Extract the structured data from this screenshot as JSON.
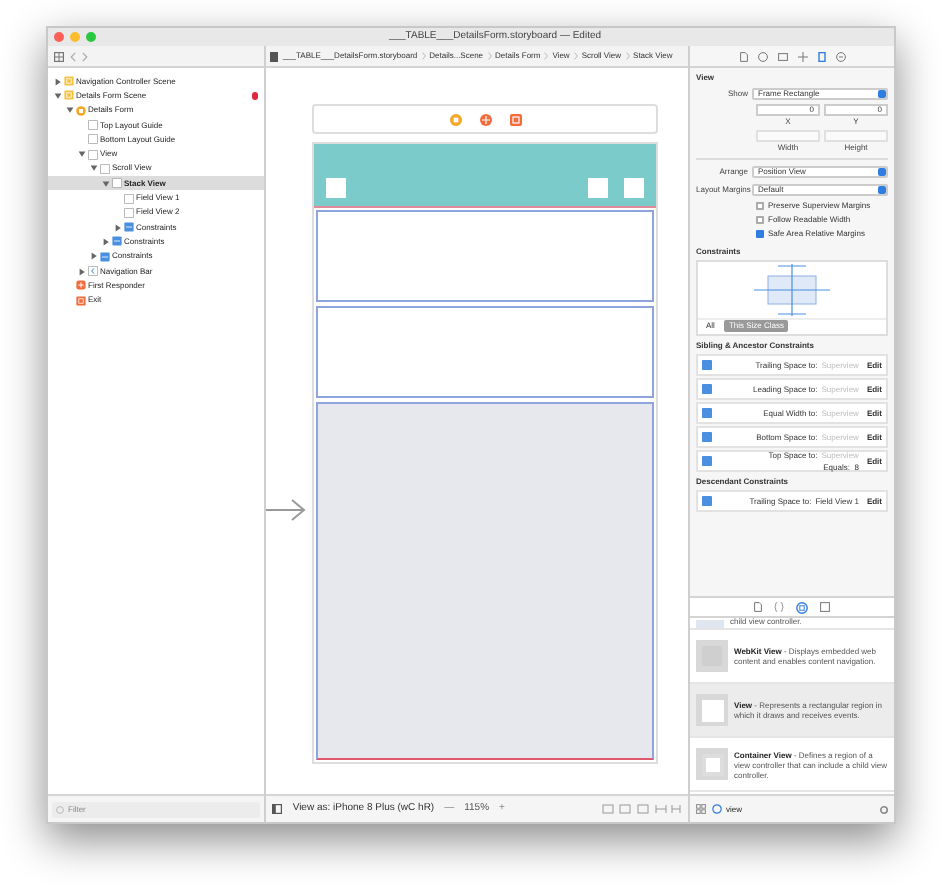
{
  "window": {
    "title": "___TABLE___DetailsForm.storyboard — Edited"
  },
  "path_bar": [
    "___TABLE___DetailsForm.storyboard",
    "Details...Scene",
    "Details Form",
    "View",
    "Scroll View",
    "Stack View"
  ],
  "outline": [
    {
      "label": "Navigation Controller Scene",
      "kind": "scene",
      "expanded": false,
      "selected": false
    },
    {
      "label": "Details Form Scene",
      "kind": "scene",
      "expanded": true,
      "selected": false,
      "error": true,
      "children": [
        {
          "label": "Details Form",
          "kind": "controller",
          "expanded": true,
          "selected": false,
          "children": [
            {
              "label": "Top Layout Guide",
              "kind": "view",
              "selected": false
            },
            {
              "label": "Bottom Layout Guide",
              "kind": "view",
              "selected": false
            },
            {
              "label": "View",
              "kind": "view",
              "expanded": true,
              "selected": false,
              "children": [
                {
                  "label": "Scroll View",
                  "kind": "view",
                  "expanded": true,
                  "selected": false,
                  "children": [
                    {
                      "label": "Stack View",
                      "kind": "view",
                      "expanded": true,
                      "selected": true,
                      "children": [
                        {
                          "label": "Field View 1",
                          "kind": "view",
                          "selected": false
                        },
                        {
                          "label": "Field View 2",
                          "kind": "view",
                          "selected": false
                        },
                        {
                          "label": "Constraints",
                          "kind": "constraints",
                          "expanded": false,
                          "selected": false
                        }
                      ]
                    },
                    {
                      "label": "Constraints",
                      "kind": "constraints",
                      "expanded": false,
                      "selected": false
                    }
                  ]
                },
                {
                  "label": "Constraints",
                  "kind": "constraints",
                  "expanded": false,
                  "selected": false
                }
              ]
            },
            {
              "label": "Navigation Bar",
              "kind": "navbar",
              "expanded": false,
              "selected": false
            }
          ]
        },
        {
          "label": "First Responder",
          "kind": "responder",
          "selected": false
        },
        {
          "label": "Exit",
          "kind": "exit",
          "selected": false
        }
      ]
    }
  ],
  "outline_filter": {
    "placeholder": "Filter"
  },
  "canvas_bar": {
    "device": "View as: iPhone 8 Plus (wC hR)",
    "zoom_out": "—",
    "zoom": "115%",
    "zoom_in": "+"
  },
  "inspector": {
    "section": "View",
    "show": {
      "label": "Show",
      "value": "Frame Rectangle"
    },
    "x": {
      "value": "0",
      "label": "X"
    },
    "y": {
      "value": "0",
      "label": "Y"
    },
    "width": {
      "label": "Width"
    },
    "height": {
      "label": "Height"
    },
    "arrange": {
      "label": "Arrange",
      "value": "Position View"
    },
    "layout_margins": {
      "label": "Layout Margins",
      "value": "Default"
    },
    "checkboxes": [
      {
        "label": "Preserve Superview Margins",
        "checked": false
      },
      {
        "label": "Follow Readable Width",
        "checked": false
      },
      {
        "label": "Safe Area Relative Margins",
        "checked": true
      }
    ],
    "constraints_title": "Constraints",
    "size_class_tabs": [
      {
        "label": "All",
        "selected": false
      },
      {
        "label": "This Size Class",
        "selected": true
      }
    ],
    "sibling_title": "Sibling & Ancestor Constraints",
    "sibling": [
      {
        "label": "Trailing Space to:",
        "target": "Superview",
        "action": "Edit"
      },
      {
        "label": "Leading Space to:",
        "target": "Superview",
        "action": "Edit"
      },
      {
        "label": "Equal Width to:",
        "target": "Superview",
        "action": "Edit"
      },
      {
        "label": "Bottom Space to:",
        "target": "Superview",
        "action": "Edit"
      },
      {
        "label": "Top Space to:",
        "target": "Superview",
        "equals": "Equals:  8",
        "action": "Edit"
      }
    ],
    "descendant_title": "Descendant Constraints",
    "descendant": [
      {
        "label": "Trailing Space to:",
        "target": "Field View 1",
        "action": "Edit"
      }
    ]
  },
  "library": {
    "cut_item": "child view controller.",
    "items": [
      {
        "title": "WebKit View",
        "description": " - Displays embedded web content and enables content navigation.",
        "kind": "webkit",
        "selected": false
      },
      {
        "title": "View",
        "description": " - Represents a rectangular region in which it draws and receives events.",
        "kind": "view",
        "selected": true
      },
      {
        "title": "Container View",
        "description": " - Defines a region of a view controller that can include a child view controller.",
        "kind": "container",
        "selected": false
      }
    ],
    "filter": {
      "value": "view"
    }
  }
}
